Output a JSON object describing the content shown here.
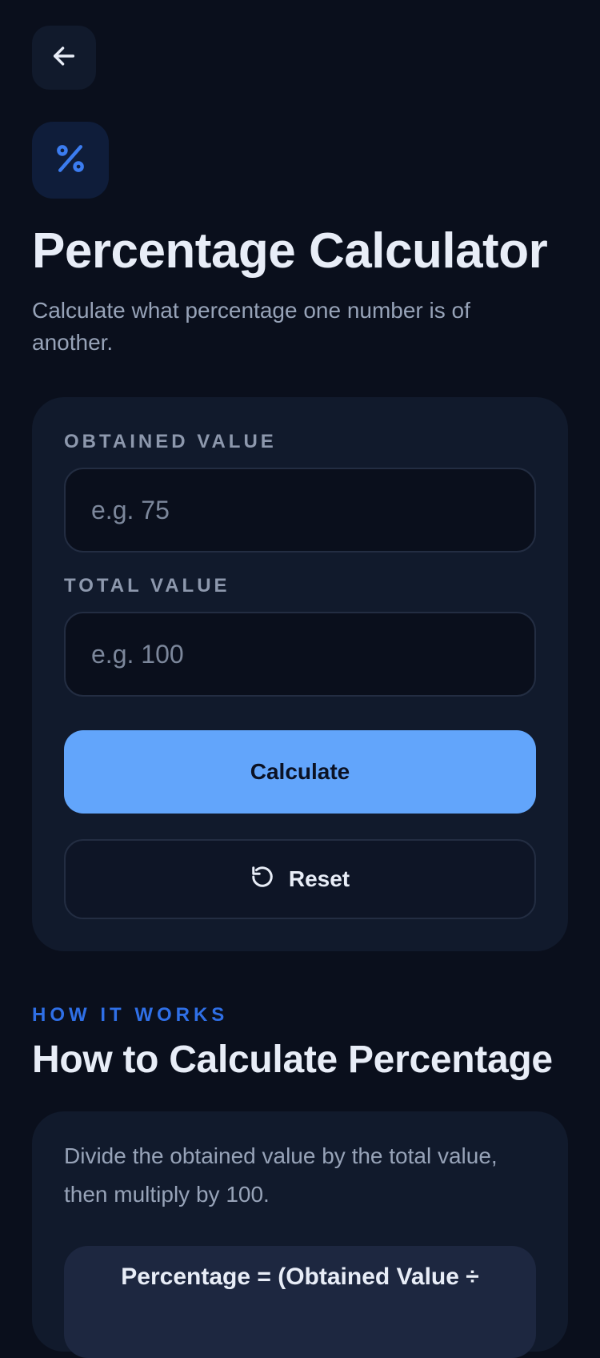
{
  "header": {
    "back_icon": "arrow-left-icon",
    "app_icon": "percent-icon"
  },
  "hero": {
    "title": "Percentage Calculator",
    "subtitle": "Calculate what percentage one number is of another."
  },
  "form": {
    "obtained": {
      "label": "OBTAINED VALUE",
      "value": "",
      "placeholder": "e.g. 75"
    },
    "total": {
      "label": "TOTAL VALUE",
      "value": "",
      "placeholder": "e.g. 100"
    },
    "calculate_label": "Calculate",
    "reset_label": "Reset",
    "reset_icon": "rotate-ccw-icon"
  },
  "how_it_works": {
    "tag": "HOW IT WORKS",
    "title": "How to Calculate Percentage",
    "description": "Divide the obtained value by the total value, then multiply by 100.",
    "formula": "Percentage = (Obtained Value ÷"
  },
  "colors": {
    "background": "#0a0f1c",
    "card": "#111a2c",
    "accent": "#62a5fb",
    "tag_blue": "#2f6fe6"
  }
}
